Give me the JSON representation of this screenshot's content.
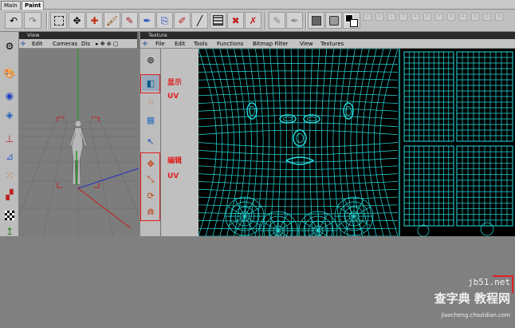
{
  "mode_tabs": [
    {
      "label": "Main",
      "active": false
    },
    {
      "label": "Paint",
      "active": true
    }
  ],
  "toolbar": {
    "tools": [
      {
        "icon": "undo-icon"
      },
      {
        "icon": "redo-icon"
      },
      {
        "icon": "selection-rect-icon"
      },
      {
        "icon": "move-brush-icon"
      },
      {
        "icon": "move-icon"
      },
      {
        "icon": "paint-brush-icon"
      },
      {
        "icon": "eraser-icon"
      },
      {
        "icon": "airbrush-icon"
      },
      {
        "icon": "clone-stamp-icon"
      },
      {
        "icon": "pipette-icon"
      },
      {
        "icon": "line-icon"
      },
      {
        "icon": "texture-view-icon"
      },
      {
        "icon": "crossed-brush-icon"
      },
      {
        "icon": "crossed-airbrush-icon"
      },
      {
        "icon": "disabled-brush-icon"
      },
      {
        "icon": "fill-icon"
      },
      {
        "icon": "color-swatch-icon"
      }
    ],
    "material_channels": [
      "C",
      "D",
      "L",
      "T",
      "R",
      "E",
      "F",
      "B",
      "A",
      "S",
      "D",
      "N"
    ]
  },
  "view_panel": {
    "title": "View",
    "menu": [
      "Edit",
      "Cameras",
      "Dis"
    ]
  },
  "texture_panel": {
    "title": "Texture",
    "menu": [
      "File",
      "Edit",
      "Tools",
      "Functions",
      "Bitmap Filter",
      "View",
      "Textures"
    ]
  },
  "annotations": {
    "show_uv": {
      "line1": "显示",
      "line2": "UV"
    },
    "edit_uv": {
      "line1": "编辑",
      "line2": "UV"
    }
  },
  "watermark": {
    "site": "jb51.net",
    "brand_cn": "查字典 教程网",
    "url": "jiaocheng.chazidian.com"
  },
  "colors": {
    "uv_mesh": "#28e0e0",
    "annotation_red": "#e02020",
    "toolbar_gray": "#c0c0c0",
    "viewport_gray": "#7d7d7d"
  }
}
